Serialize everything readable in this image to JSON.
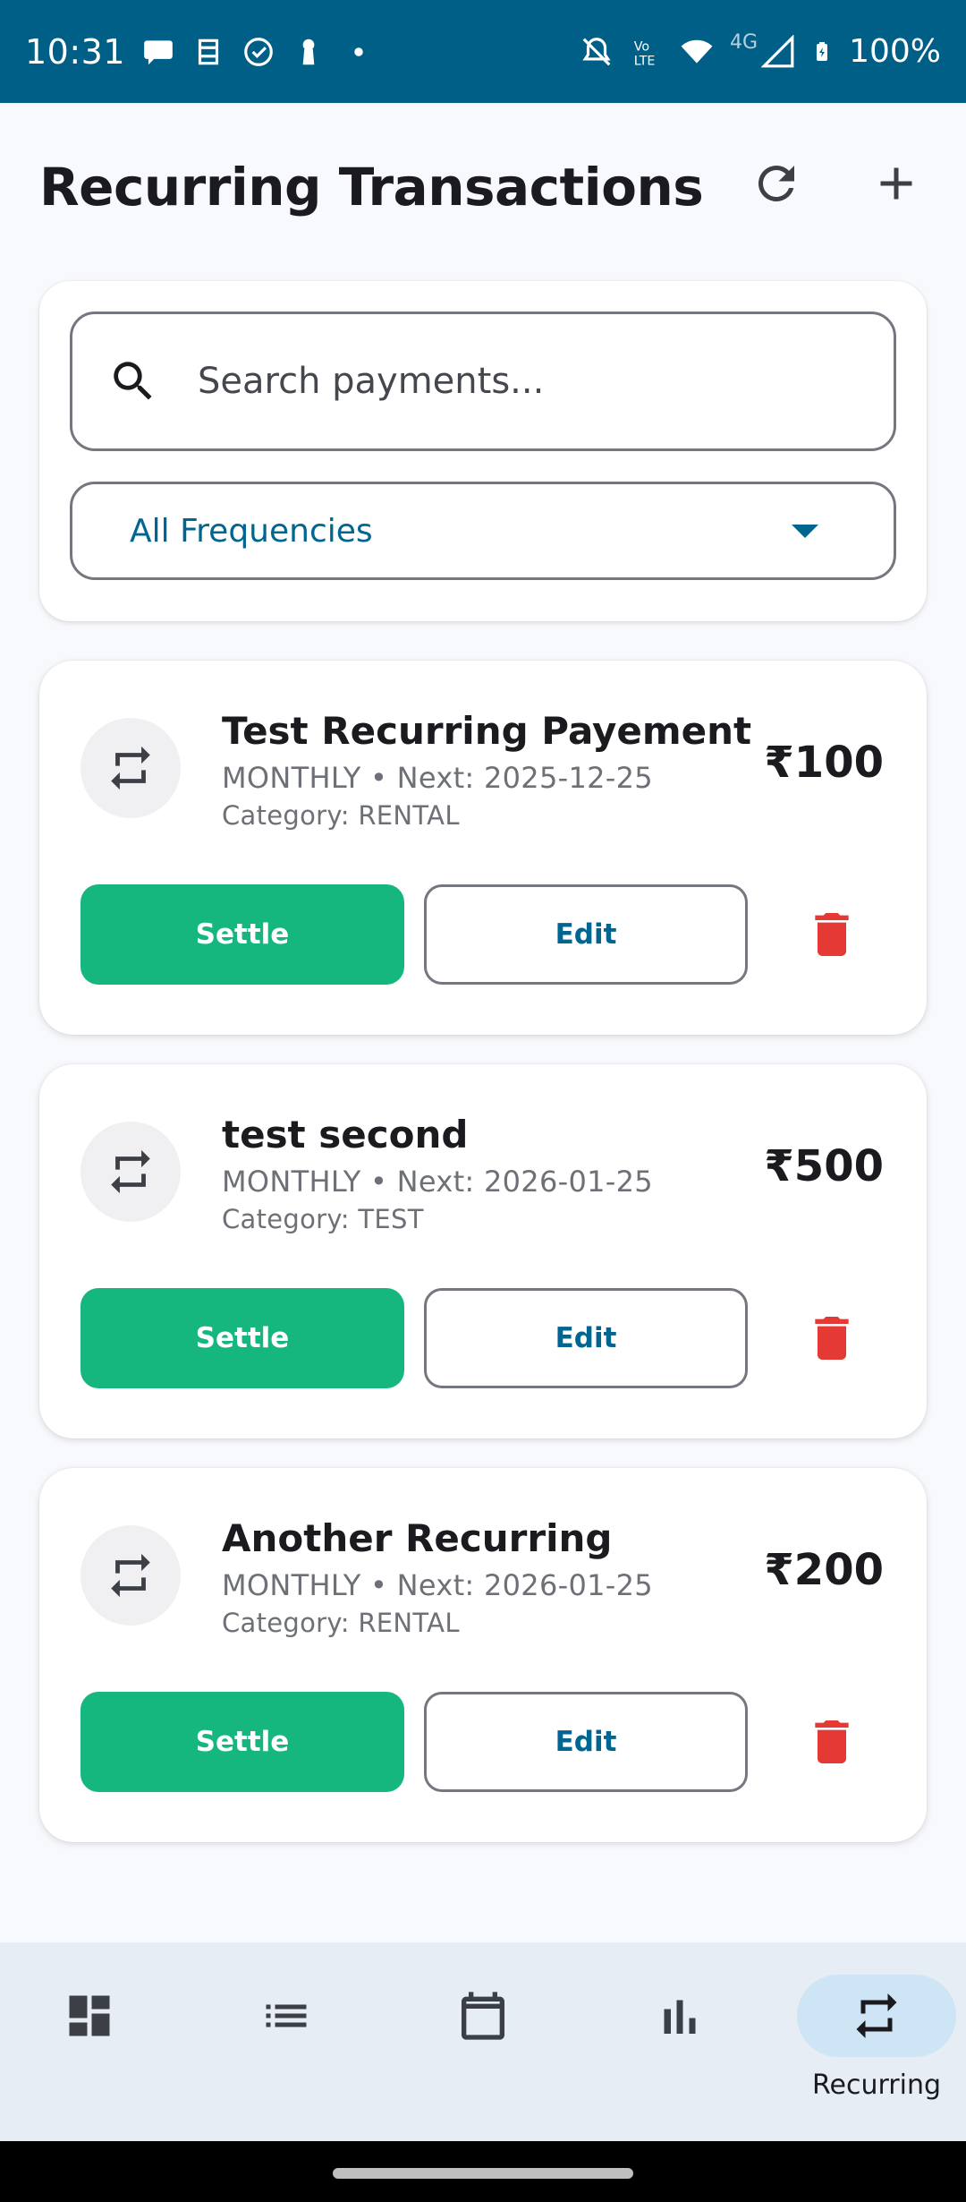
{
  "status_bar": {
    "time": "10:31",
    "battery": "100%",
    "network": "4G"
  },
  "header": {
    "title": "Recurring Transactions"
  },
  "filters": {
    "search_placeholder": "Search payments...",
    "frequency_selected": "All Frequencies"
  },
  "transactions": [
    {
      "name": "Test Recurring Payement",
      "meta": "MONTHLY • Next: 2025-12-25",
      "category": "Category: RENTAL",
      "amount": "₹100",
      "settle_label": "Settle",
      "edit_label": "Edit"
    },
    {
      "name": "test second",
      "meta": "MONTHLY • Next: 2026-01-25",
      "category": "Category: TEST",
      "amount": "₹500",
      "settle_label": "Settle",
      "edit_label": "Edit"
    },
    {
      "name": "Another Recurring",
      "meta": "MONTHLY • Next: 2026-01-25",
      "category": "Category: RENTAL",
      "amount": "₹200",
      "settle_label": "Settle",
      "edit_label": "Edit"
    }
  ],
  "bottom_nav": {
    "items": [
      {
        "icon": "dashboard-icon",
        "label": ""
      },
      {
        "icon": "list-icon",
        "label": ""
      },
      {
        "icon": "calendar-icon",
        "label": ""
      },
      {
        "icon": "bar-chart-icon",
        "label": ""
      },
      {
        "icon": "repeat-icon",
        "label": "Recurring",
        "active": true
      }
    ]
  },
  "colors": {
    "status_bar": "#005f87",
    "settle": "#16b77f",
    "accent": "#006590",
    "delete": "#e53935",
    "nav_active_pill": "#cde5f5"
  }
}
